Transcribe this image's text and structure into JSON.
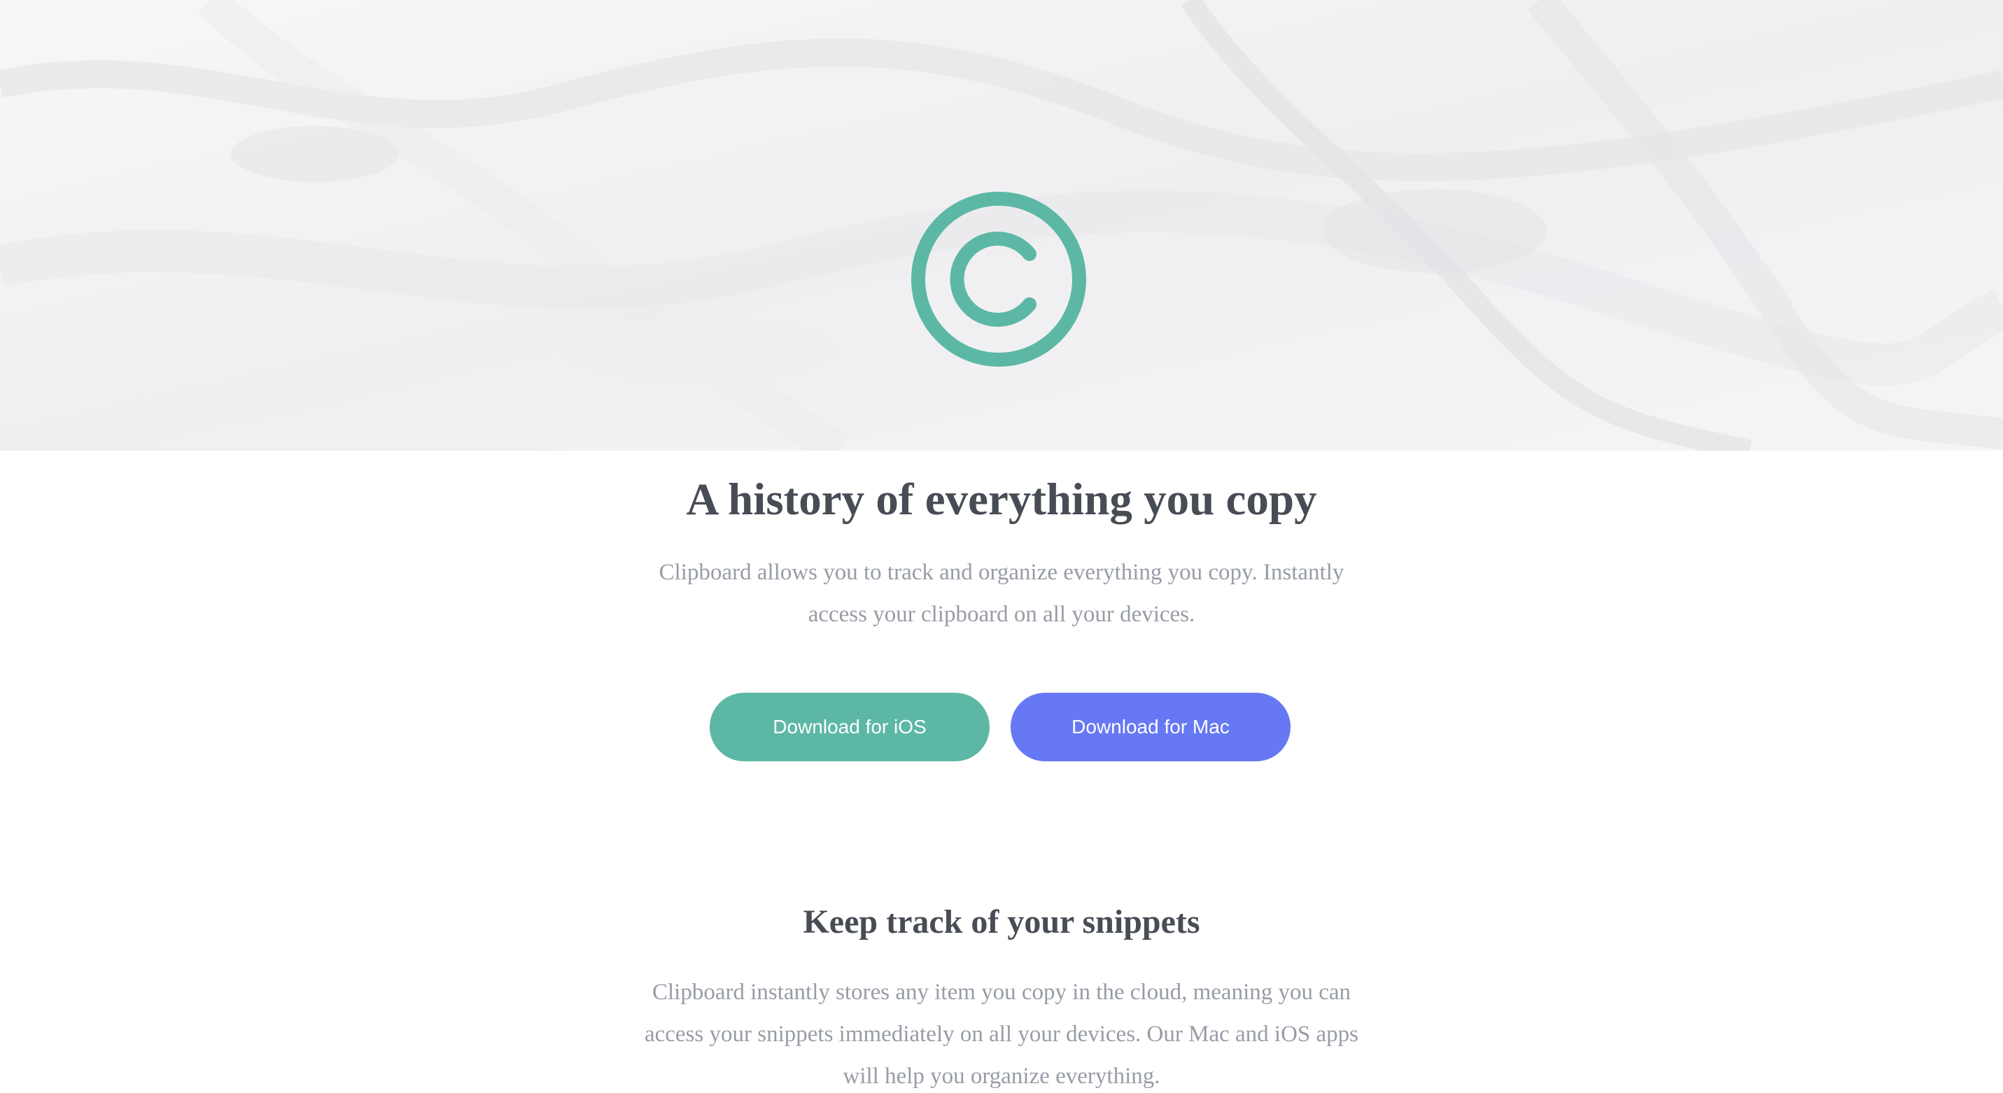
{
  "hero": {
    "logo_icon": "copyright-circle-icon",
    "accent_color": "#5cb8a4"
  },
  "main": {
    "headline": "A history of everything you copy",
    "description": "Clipboard allows you to track and organize everything you copy. Instantly access your clipboard on all your devices.",
    "buttons": {
      "ios": {
        "label": "Download for iOS",
        "color": "#5cb8a4"
      },
      "mac": {
        "label": "Download for Mac",
        "color": "#6678f3"
      }
    }
  },
  "features": {
    "title": "Keep track of your snippets",
    "description": "Clipboard instantly stores any item you copy in the cloud, meaning you can access your snippets immediately on all your devices. Our Mac and iOS apps will help you organize everything."
  }
}
